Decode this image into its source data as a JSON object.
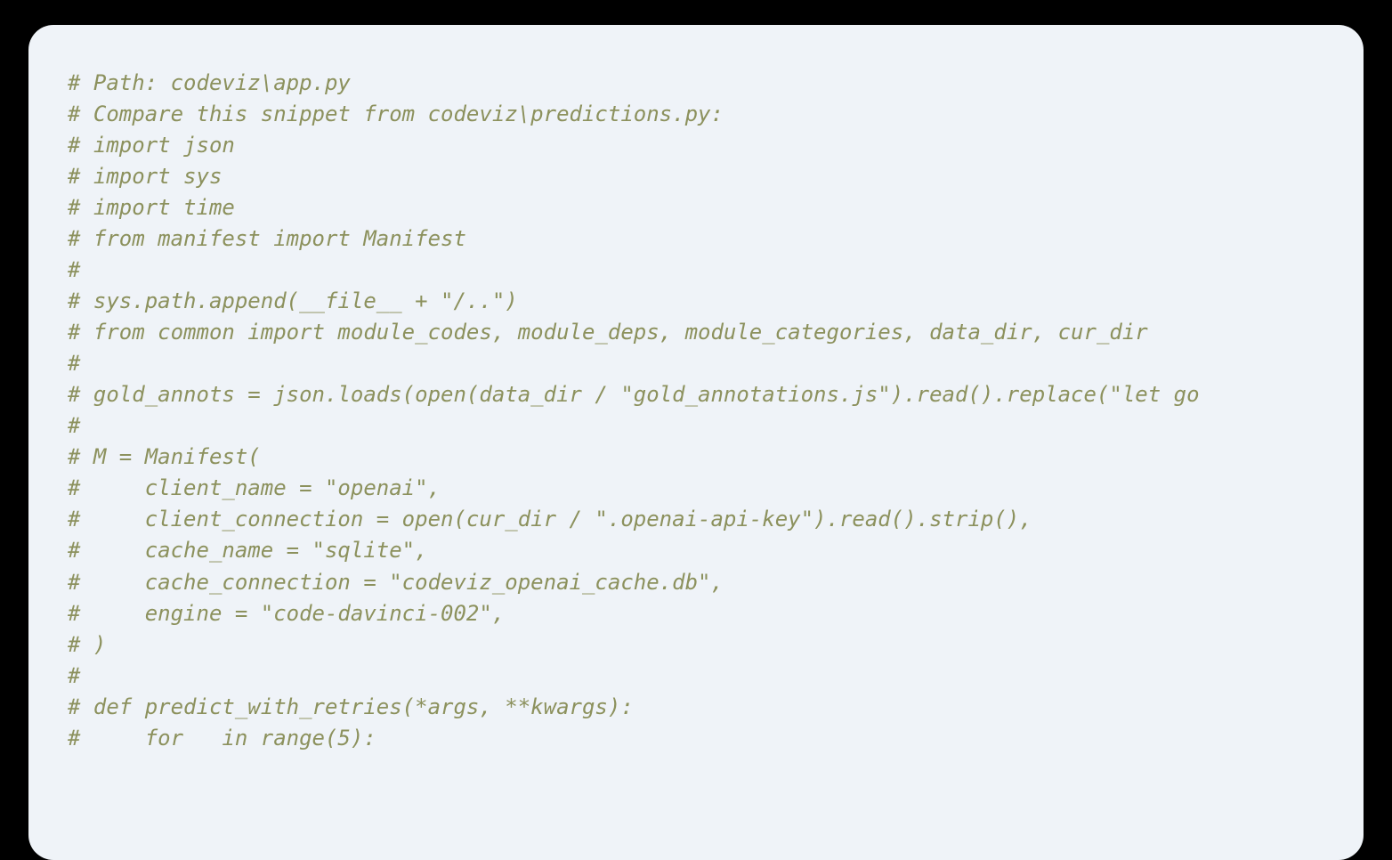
{
  "code_lines": [
    "# Path: codeviz\\app.py",
    "# Compare this snippet from codeviz\\predictions.py:",
    "# import json",
    "# import sys",
    "# import time",
    "# from manifest import Manifest",
    "#",
    "# sys.path.append(__file__ + \"/..\")",
    "# from common import module_codes, module_deps, module_categories, data_dir, cur_dir",
    "#",
    "# gold_annots = json.loads(open(data_dir / \"gold_annotations.js\").read().replace(\"let go",
    "#",
    "# M = Manifest(",
    "#     client_name = \"openai\",",
    "#     client_connection = open(cur_dir / \".openai-api-key\").read().strip(),",
    "#     cache_name = \"sqlite\",",
    "#     cache_connection = \"codeviz_openai_cache.db\",",
    "#     engine = \"code-davinci-002\",",
    "# )",
    "#",
    "# def predict_with_retries(*args, **kwargs):",
    "#     for   in range(5):"
  ]
}
